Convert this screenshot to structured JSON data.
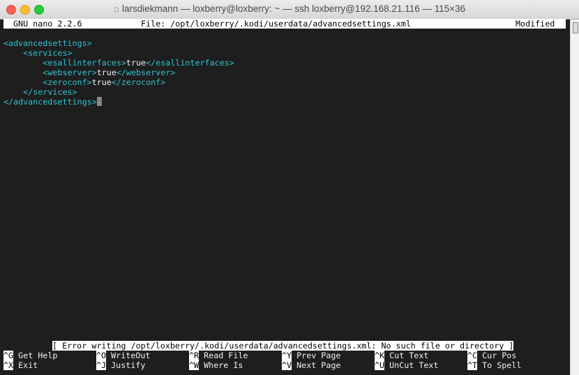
{
  "window": {
    "title": "larsdiekmann — loxberry@loxberry: ~ — ssh loxberry@192.168.21.116 — 115×36"
  },
  "nano": {
    "version": "GNU nano 2.2.6",
    "file": "File: /opt/loxberry/.kodi/userdata/advancedsettings.xml",
    "state": "Modified"
  },
  "lines": [
    {
      "indent": "",
      "open": "<advancedsettings>",
      "value": "",
      "close": ""
    },
    {
      "indent": "    ",
      "open": "<services>",
      "value": "",
      "close": ""
    },
    {
      "indent": "        ",
      "open": "<esallinterfaces>",
      "value": "true",
      "close": "</esallinterfaces>"
    },
    {
      "indent": "        ",
      "open": "<webserver>",
      "value": "true",
      "close": "</webserver>"
    },
    {
      "indent": "        ",
      "open": "<zeroconf>",
      "value": "true",
      "close": "</zeroconf>"
    },
    {
      "indent": "    ",
      "open": "</services>",
      "value": "",
      "close": ""
    },
    {
      "indent": "",
      "open": "</advancedsettings>",
      "value": "",
      "close": ""
    }
  ],
  "error": "[ Error writing /opt/loxberry/.kodi/userdata/advancedsettings.xml: No such file or directory ]",
  "shortcuts": [
    [
      {
        "key": "^G",
        "label": "Get Help"
      },
      {
        "key": "^O",
        "label": "WriteOut"
      },
      {
        "key": "^R",
        "label": "Read File"
      },
      {
        "key": "^Y",
        "label": "Prev Page"
      },
      {
        "key": "^K",
        "label": "Cut Text"
      },
      {
        "key": "^C",
        "label": "Cur Pos"
      }
    ],
    [
      {
        "key": "^X",
        "label": "Exit"
      },
      {
        "key": "^J",
        "label": "Justify"
      },
      {
        "key": "^W",
        "label": "Where Is"
      },
      {
        "key": "^V",
        "label": "Next Page"
      },
      {
        "key": "^U",
        "label": "UnCut Text"
      },
      {
        "key": "^T",
        "label": "To Spell"
      }
    ]
  ]
}
